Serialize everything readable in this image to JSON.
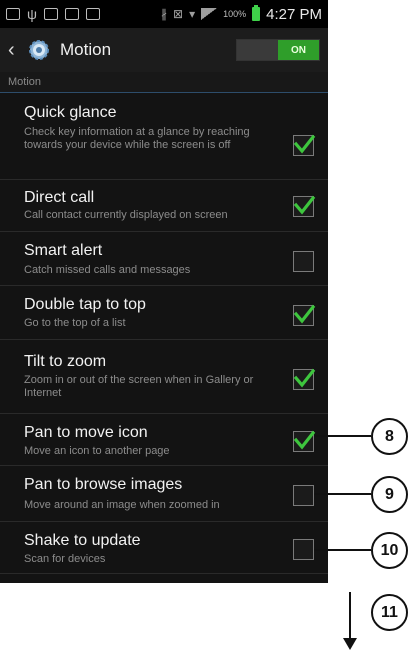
{
  "status_bar": {
    "battery_percent": "100%",
    "time": "4:27 PM"
  },
  "action_bar": {
    "title": "Motion",
    "toggle_label": "ON",
    "toggle_color": "#2f9e2a"
  },
  "section_header": "Motion",
  "settings": [
    {
      "title": "Quick glance",
      "description": "Check key information at a glance by reaching towards your device while the screen is off",
      "checked": true
    },
    {
      "title": "Direct call",
      "description": "Call contact currently displayed on screen",
      "checked": true
    },
    {
      "title": "Smart alert",
      "description": "Catch missed calls and messages",
      "checked": false
    },
    {
      "title": "Double tap to top",
      "description": "Go to the top of a list",
      "checked": true
    },
    {
      "title": "Tilt to zoom",
      "description": "Zoom in or out of the screen when in Gallery or Internet",
      "checked": true
    },
    {
      "title": "Pan to move icon",
      "description": "Move an icon to another page",
      "checked": true
    },
    {
      "title": "Pan to browse images",
      "description": "Move around an image when zoomed in",
      "checked": false
    },
    {
      "title": "Shake to update",
      "description": "Scan for devices",
      "checked": false
    }
  ],
  "callouts": [
    "8",
    "9",
    "10",
    "11"
  ],
  "check_color": "#3ec63e"
}
